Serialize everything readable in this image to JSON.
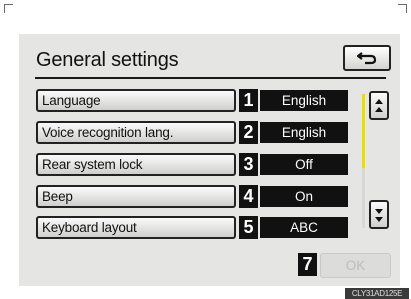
{
  "header": {
    "title": "General settings",
    "back_icon": "back-arrow-icon"
  },
  "settings": [
    {
      "label": "Language",
      "number": "1",
      "value": "English"
    },
    {
      "label": "Voice recognition lang.",
      "number": "2",
      "value": "English"
    },
    {
      "label": "Rear system lock",
      "number": "3",
      "value": "Off"
    },
    {
      "label": "Beep",
      "number": "4",
      "value": "On"
    },
    {
      "label": "Keyboard layout",
      "number": "5",
      "value": "ABC"
    }
  ],
  "scroll": {
    "up_icon": "scroll-up-arrows-icon",
    "down_icon": "scroll-down-arrows-icon",
    "thumb_color": "#e8e000"
  },
  "footer": {
    "ok_number": "7",
    "ok_label": "OK"
  },
  "image_code": "CLY31AD125E"
}
